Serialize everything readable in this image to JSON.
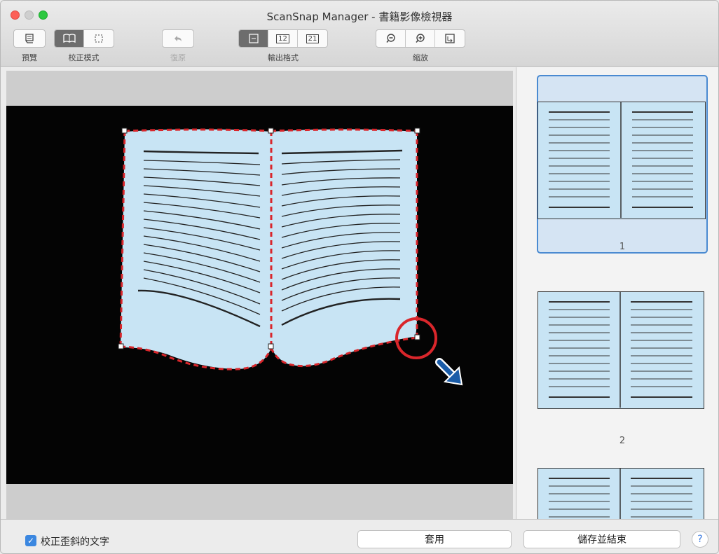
{
  "window": {
    "title": "ScanSnap Manager - 書籍影像檢視器"
  },
  "toolbar": {
    "preview_label": "預覽",
    "correction_mode_label": "校正模式",
    "undo_label": "復原",
    "output_format_label": "輸出格式",
    "zoom_label": "縮放",
    "output_buttons": [
      "",
      "12",
      "21"
    ]
  },
  "thumbnails": [
    {
      "number": "1"
    },
    {
      "number": "2"
    }
  ],
  "bottom": {
    "checkbox_label": "校正歪斜的文字",
    "apply_button": "套用",
    "save_exit_button": "儲存並結束",
    "help": "?"
  }
}
